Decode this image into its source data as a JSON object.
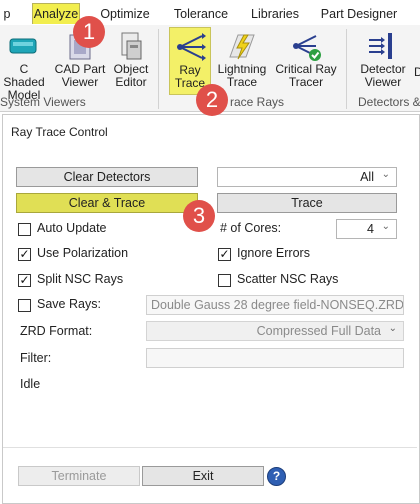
{
  "ribbon_tabs": [
    "p",
    "Analyze",
    "Optimize",
    "Tolerance",
    "Libraries",
    "Part Designer"
  ],
  "ribbon_buttons": {
    "shaded_model": "C Shaded\nModel",
    "cad_part_viewer": "CAD Part\nViewer",
    "object_editor": "Object\nEditor",
    "ray_trace": "Ray\nTrace",
    "lightning_trace": "Lightning\nTrace",
    "critical_ray_tracer": "Critical Ray\nTracer",
    "detector_viewer": "Detector\nViewer",
    "cut_off_button": "D"
  },
  "ribbon_groups": {
    "system_viewers": "System Viewers",
    "trace_rays": "race Rays",
    "detectors": "Detectors &"
  },
  "callouts": [
    "1",
    "2",
    "3"
  ],
  "dialog": {
    "title": "Ray Trace Control",
    "clear_detectors": "Clear Detectors",
    "detector_select": "All",
    "clear_and_trace": "Clear & Trace",
    "trace": "Trace",
    "auto_update": "Auto Update",
    "num_cores_label": "# of Cores:",
    "num_cores_value": "4",
    "use_polarization": "Use Polarization",
    "ignore_errors": "Ignore Errors",
    "split_nsc_rays": "Split NSC Rays",
    "scatter_nsc_rays": "Scatter NSC Rays",
    "save_rays": "Save Rays:",
    "save_rays_file": "Double Gauss 28 degree field-NONSEQ.ZRD",
    "zrd_format_label": "ZRD Format:",
    "zrd_format_value": "Compressed Full Data",
    "filter_label": "Filter:",
    "filter_value": "",
    "status": "Idle",
    "terminate": "Terminate",
    "exit": "Exit",
    "help": "?"
  },
  "checkbox_states": {
    "auto_update": false,
    "use_polarization": true,
    "ignore_errors": true,
    "split_nsc_rays": true,
    "scatter_nsc_rays": false,
    "save_rays": false
  },
  "colors": {
    "active_tab": "#f2ee4e",
    "highlight_button": "#e0df55",
    "callout": "#e0504a"
  }
}
